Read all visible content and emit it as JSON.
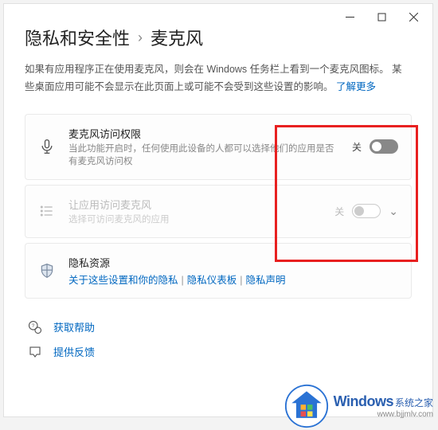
{
  "breadcrumb": {
    "parent": "隐私和安全性",
    "current": "麦克风"
  },
  "description": {
    "text": "如果有应用程序正在使用麦克风，则会在 Windows 任务栏上看到一个麦克风图标。 某些桌面应用可能不会显示在此页面上或可能不会受到这些设置的影响。 ",
    "learn_more": "了解更多"
  },
  "cards": {
    "mic_access": {
      "title": "麦克风访问权限",
      "subtitle": "当此功能开启时，任何使用此设备的人都可以选择他们的应用是否有麦克风访问权",
      "state": "关"
    },
    "app_access": {
      "title": "让应用访问麦克风",
      "subtitle": "选择可访问麦克风的应用",
      "state": "关"
    },
    "privacy_res": {
      "title": "隐私资源",
      "link1": "关于这些设置和你的隐私",
      "link2": "隐私仪表板",
      "link3": "隐私声明"
    }
  },
  "footer": {
    "help": "获取帮助",
    "feedback": "提供反馈"
  },
  "watermark": {
    "brand": "Windows",
    "sub": "系统之家",
    "url": "www.bjjmlv.com"
  }
}
